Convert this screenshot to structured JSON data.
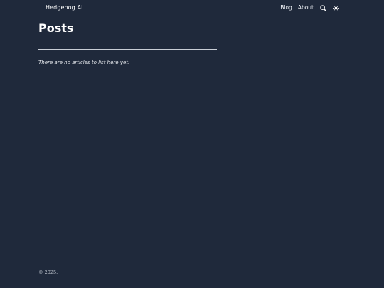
{
  "header": {
    "site_title": "Hedgehog AI",
    "nav": [
      {
        "label": "Blog"
      },
      {
        "label": "About"
      }
    ],
    "icons": [
      "search-icon",
      "theme-toggle-sun-icon"
    ]
  },
  "main": {
    "title": "Posts",
    "empty_message": "There are no articles to list here yet."
  },
  "footer": {
    "copyright": "© 2025."
  },
  "colors": {
    "background": "#1f293b",
    "text": "#ffffff",
    "divider": "#c9ced6"
  }
}
